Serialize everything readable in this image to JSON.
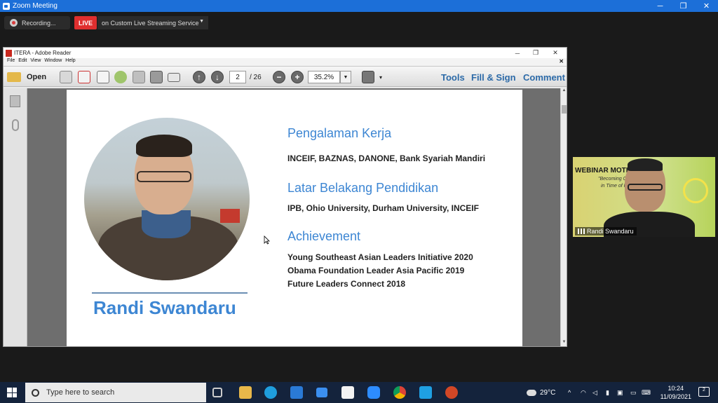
{
  "zoom": {
    "title": "Zoom Meeting",
    "recording_label": "Recording...",
    "live_badge": "LIVE",
    "stream_label": "on Custom Live Streaming Service"
  },
  "adobe": {
    "title": "ITERA - Adobe Reader",
    "menu": [
      "File",
      "Edit",
      "View",
      "Window",
      "Help"
    ],
    "open_label": "Open",
    "page_current": "2",
    "page_total": "/ 26",
    "zoom_level": "35.2%",
    "tools_label": "Tools",
    "fill_sign_label": "Fill & Sign",
    "comment_label": "Comment"
  },
  "slide": {
    "name": "Randi Swandaru",
    "sections": [
      {
        "heading": "Pengalaman Kerja",
        "lines": [
          "INCEIF, BAZNAS, DANONE, Bank Syariah Mandiri"
        ]
      },
      {
        "heading": "Latar Belakang Pendidikan",
        "lines": [
          "IPB, Ohio University, Durham University, INCEIF"
        ]
      },
      {
        "heading": "Achievement",
        "lines": [
          "Young Southeast Asian Leaders Initiative 2020",
          "Obama Foundation Leader Asia Pacific 2019",
          "Future Leaders Connect 2018"
        ]
      }
    ]
  },
  "video_tile": {
    "banner_title": "WEBINAR MOTIV",
    "banner_sub1": "\"Becoming Cr",
    "banner_sub2": "in Time of Pa",
    "participant_name": "Randi Swandaru"
  },
  "taskbar": {
    "search_placeholder": "Type here to search",
    "weather": "29°C",
    "time": "10:24",
    "date": "11/09/2021",
    "notifications": "2"
  },
  "colors": {
    "zoom_blue": "#1c6fd8",
    "live_red": "#e02f2f",
    "slide_blue": "#3d86d3",
    "adobe_link": "#2c6aa8",
    "taskbar": "#14233c"
  }
}
